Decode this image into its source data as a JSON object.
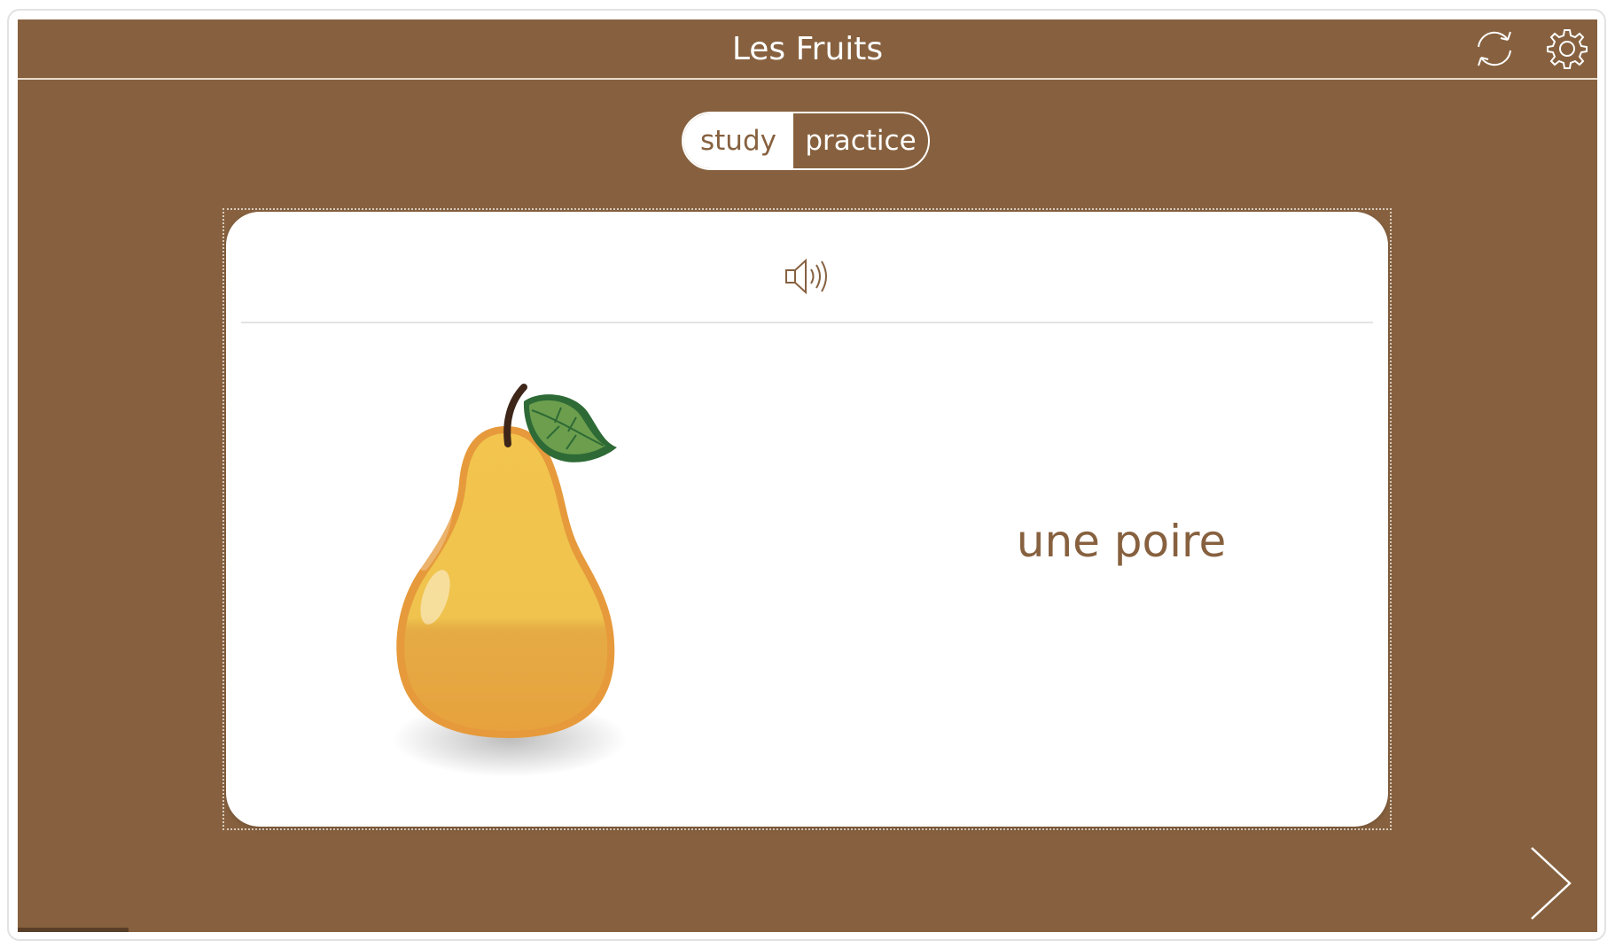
{
  "app": {
    "title": "Les Fruits",
    "colors": {
      "background": "#87613f",
      "text_accent": "#87613f",
      "white": "#ffffff"
    }
  },
  "header": {
    "refresh_icon": "refresh-icon",
    "settings_icon": "gear-icon"
  },
  "mode_switch": {
    "selected": "study",
    "study_label": "study",
    "practice_label": "practice"
  },
  "card": {
    "audio_icon": "speaker-icon",
    "image": "pear",
    "word": "une poire"
  },
  "navigation": {
    "next_icon": "chevron-right-icon"
  },
  "progress": {
    "fraction": 0.07
  }
}
